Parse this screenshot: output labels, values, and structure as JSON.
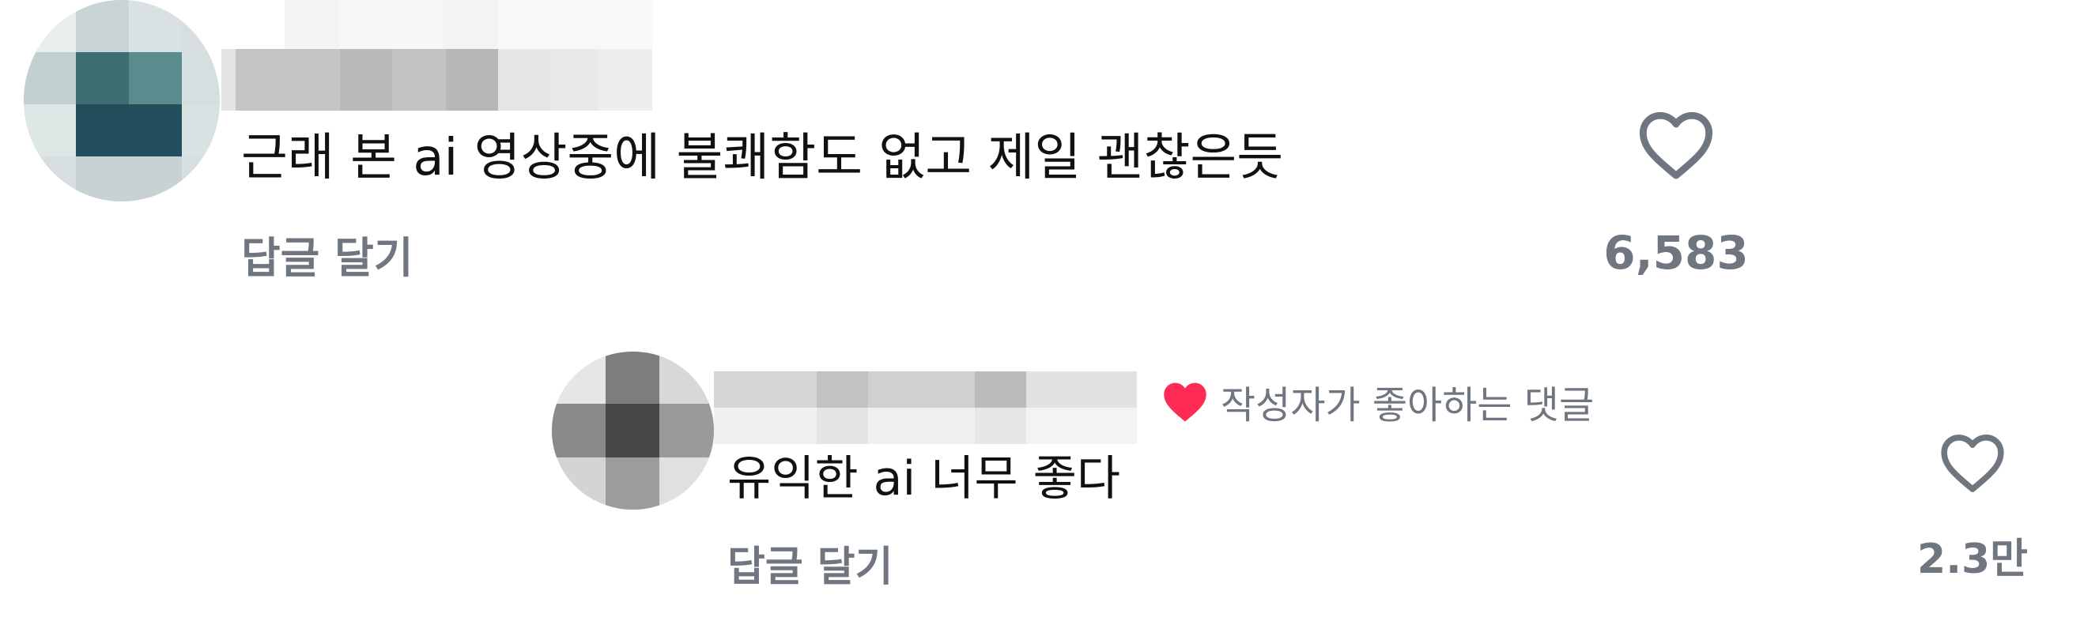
{
  "comments": [
    {
      "text": "근래 본 ai 영상중에 불쾌함도 없고 제일 괜찮은듯",
      "reply_label": "답글 달기",
      "like_count": "6,583"
    }
  ],
  "reply": {
    "creator_badge": "작성자가 좋아하는 댓글",
    "text": "유익한 ai 너무 좋다",
    "reply_label": "답글 달기",
    "like_count": "2.3만"
  },
  "colors": {
    "text_primary": "#111111",
    "text_secondary": "#6f7680",
    "heart_outline": "#6f7680",
    "creator_heart": "#fe2c55"
  },
  "icons": {
    "like": "heart-outline-icon",
    "creator_like": "heart-filled-icon"
  }
}
